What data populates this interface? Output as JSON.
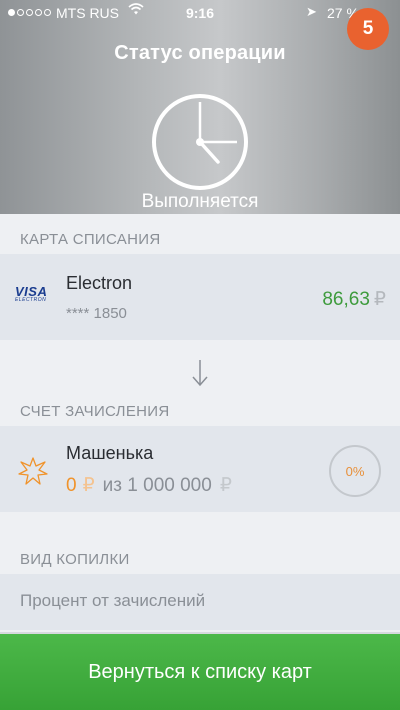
{
  "status_bar": {
    "carrier": "MTS RUS",
    "time": "9:16",
    "battery": "27 %"
  },
  "badge": {
    "count": "5"
  },
  "header": {
    "title": "Статус операции",
    "status": "Выполняется",
    "icon": "clock-icon"
  },
  "debit": {
    "section_label": "КАРТА СПИСАНИЯ",
    "card_brand": "VISA",
    "card_brand_sub": "ELECTRON",
    "card_name": "Electron",
    "card_number": "**** 1850",
    "amount": "86,63",
    "currency": "₽"
  },
  "credit": {
    "section_label": "СЧЕТ ЗАЧИСЛЕНИЯ",
    "account_name": "Машенька",
    "balance": "0",
    "currency": "₽",
    "from_text": "из 1 000 000",
    "percent": "0%",
    "percent_fraction": 0
  },
  "piggy_type": {
    "section_label": "ВИД КОПИЛКИ",
    "value": "Процент от зачислений"
  },
  "footer": {
    "button_label": "Вернуться к списку карт"
  },
  "colors": {
    "accent_green": "#3e9b3d",
    "badge_orange": "#e9622f",
    "balance_orange": "#f0932b"
  }
}
